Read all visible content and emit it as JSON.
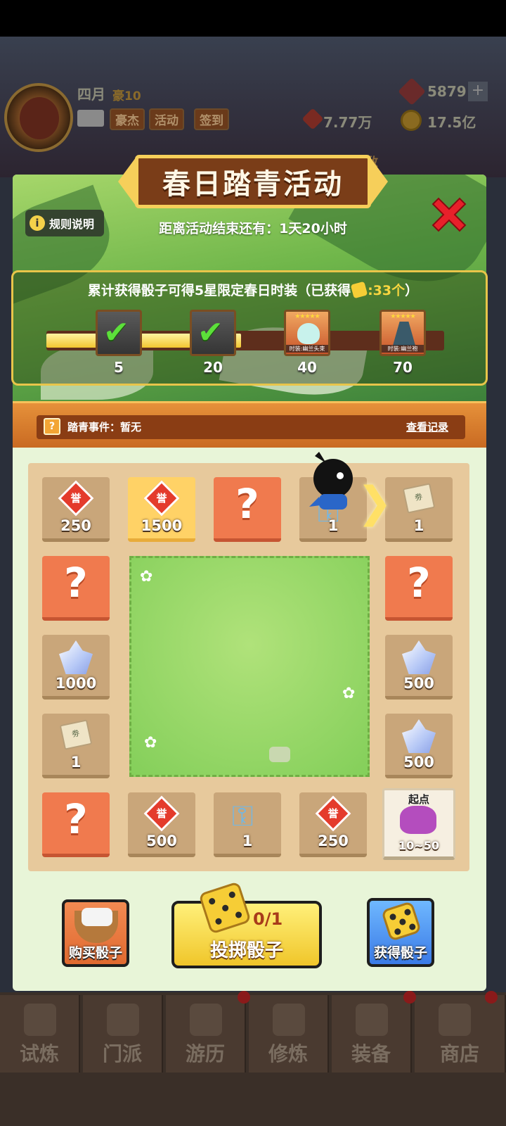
{
  "hud": {
    "player_name": "四月",
    "vip": "豪10",
    "tags": [
      "豪杰",
      "活动",
      "签到"
    ],
    "gems": "5879",
    "power": "7.77万",
    "coins": "17.5亿",
    "side_label": "动敌"
  },
  "event": {
    "title": "春日踏青活动",
    "rules_label": "规则说明",
    "countdown": "距离活动结束还有：1天20小时",
    "progress_prefix": "累计获得骰子可得5星限定春日时装（已获得",
    "progress_count": ":33个",
    "progress_suffix": "）",
    "progress_fraction": 0.49,
    "milestones": [
      {
        "num": "5",
        "state": "done"
      },
      {
        "num": "20",
        "state": "done"
      },
      {
        "num": "40",
        "state": "reward",
        "label": "时装:幽兰头束",
        "stars": "★★★★★"
      },
      {
        "num": "70",
        "state": "reward",
        "label": "时装:幽兰袍",
        "stars": "★★★★★"
      }
    ],
    "news_icon": "?",
    "news_text": "踏青事件：暂无",
    "record_link": "查看记录"
  },
  "board": {
    "tiles": {
      "t1": "250",
      "t2": "1500",
      "t4": "1",
      "t5": "1",
      "l2": "1000",
      "l3": "1",
      "r2": "500",
      "r3": "500",
      "b2": "500",
      "b3": "1",
      "b4": "250",
      "start_label": "起点",
      "start_value": "10~50"
    },
    "honor_glyph": "誉",
    "scroll_glyph": "劵",
    "question_glyph": "?",
    "arrow_glyph": "❯"
  },
  "actions": {
    "buy_label": "购买骰子",
    "roll_count": "0/1",
    "roll_label": "投掷骰子",
    "get_label": "获得骰子"
  },
  "nav": [
    "试炼",
    "门派",
    "游历",
    "修炼",
    "装备",
    "商店"
  ],
  "colors": {
    "accent": "#f6cf5a",
    "panel": "#e8f5d8",
    "question_tile": "#f07a4e"
  }
}
